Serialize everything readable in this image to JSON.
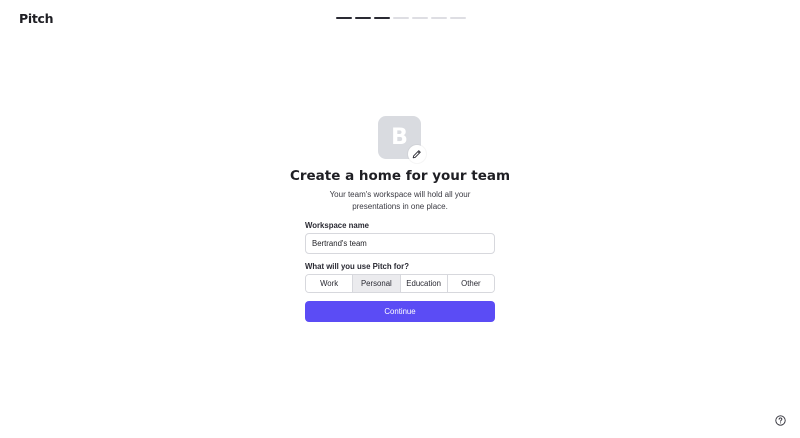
{
  "brand": {
    "logo_text": "Pitch"
  },
  "progress": {
    "total_steps": 7,
    "completed_steps": 3
  },
  "avatar": {
    "initial": "B",
    "edit_icon": "pencil-icon"
  },
  "heading": {
    "title": "Create a home for your team",
    "subtitle": "Your team's workspace will hold all your presentations in one place."
  },
  "form": {
    "workspace_label": "Workspace name",
    "workspace_value": "Bertrand's team",
    "usage_label": "What will you use Pitch for?",
    "usage_options": [
      "Work",
      "Personal",
      "Education",
      "Other"
    ],
    "usage_selected": "Personal",
    "continue_label": "Continue"
  },
  "colors": {
    "accent": "#5b4cf5",
    "progress_done": "#2a2a33",
    "progress_todo": "#dedee3",
    "avatar_bg": "#d9dbe0"
  },
  "help": {
    "icon": "question-circle-icon"
  }
}
